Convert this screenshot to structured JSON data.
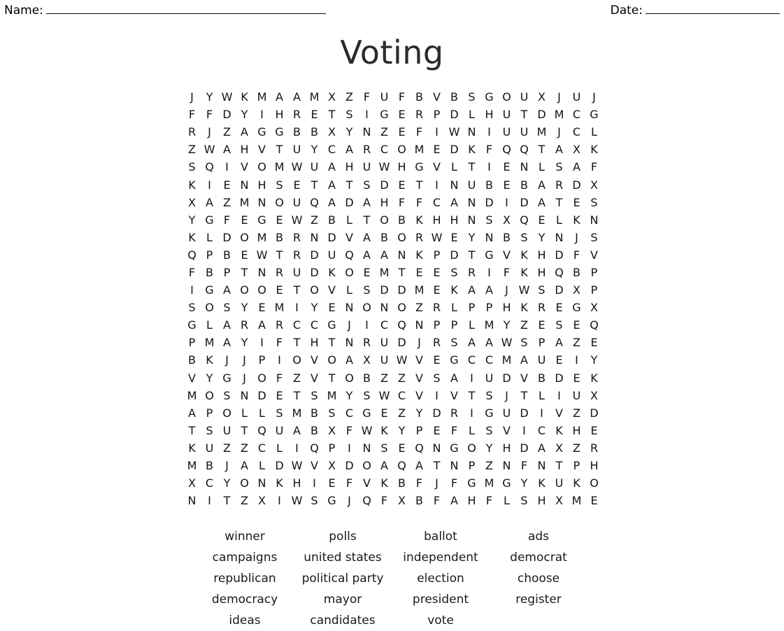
{
  "header": {
    "name_label": "Name:",
    "date_label": "Date:"
  },
  "title": "Voting",
  "grid": {
    "rows": 24,
    "cols": 24,
    "letters": [
      [
        "J",
        "Y",
        "W",
        "K",
        "M",
        "A",
        "A",
        "M",
        "X",
        "Z",
        "F",
        "U",
        "F",
        "B",
        "V",
        "B",
        "S",
        "G",
        "O",
        "U",
        "X",
        "J",
        "U",
        "J"
      ],
      [
        "F",
        "F",
        "D",
        "Y",
        "I",
        "H",
        "R",
        "E",
        "T",
        "S",
        "I",
        "G",
        "E",
        "R",
        "P",
        "D",
        "L",
        "H",
        "U",
        "T",
        "D",
        "M",
        "C",
        "G"
      ],
      [
        "R",
        "J",
        "Z",
        "A",
        "G",
        "G",
        "B",
        "B",
        "X",
        "Y",
        "N",
        "Z",
        "E",
        "F",
        "I",
        "W",
        "N",
        "I",
        "U",
        "U",
        "M",
        "J",
        "C",
        "L"
      ],
      [
        "Z",
        "W",
        "A",
        "H",
        "V",
        "T",
        "U",
        "Y",
        "C",
        "A",
        "R",
        "C",
        "O",
        "M",
        "E",
        "D",
        "K",
        "F",
        "Q",
        "Q",
        "T",
        "A",
        "X",
        "K"
      ],
      [
        "S",
        "Q",
        "I",
        "V",
        "O",
        "M",
        "W",
        "U",
        "A",
        "H",
        "U",
        "W",
        "H",
        "G",
        "V",
        "L",
        "T",
        "I",
        "E",
        "N",
        "L",
        "S",
        "A",
        "F"
      ],
      [
        "K",
        "I",
        "E",
        "N",
        "H",
        "S",
        "E",
        "T",
        "A",
        "T",
        "S",
        "D",
        "E",
        "T",
        "I",
        "N",
        "U",
        "B",
        "E",
        "B",
        "A",
        "R",
        "D",
        "X"
      ],
      [
        "X",
        "A",
        "Z",
        "M",
        "N",
        "O",
        "U",
        "Q",
        "A",
        "D",
        "A",
        "H",
        "F",
        "F",
        "C",
        "A",
        "N",
        "D",
        "I",
        "D",
        "A",
        "T",
        "E",
        "S"
      ],
      [
        "Y",
        "G",
        "F",
        "E",
        "G",
        "E",
        "W",
        "Z",
        "B",
        "L",
        "T",
        "O",
        "B",
        "K",
        "H",
        "H",
        "N",
        "S",
        "X",
        "Q",
        "E",
        "L",
        "K",
        "N"
      ],
      [
        "K",
        "L",
        "D",
        "O",
        "M",
        "B",
        "R",
        "N",
        "D",
        "V",
        "A",
        "B",
        "O",
        "R",
        "W",
        "E",
        "Y",
        "N",
        "B",
        "S",
        "Y",
        "N",
        "J",
        "S"
      ],
      [
        "Q",
        "P",
        "B",
        "E",
        "W",
        "T",
        "R",
        "D",
        "U",
        "Q",
        "A",
        "A",
        "N",
        "K",
        "P",
        "D",
        "T",
        "G",
        "V",
        "K",
        "H",
        "D",
        "F",
        "V"
      ],
      [
        "F",
        "B",
        "P",
        "T",
        "N",
        "R",
        "U",
        "D",
        "K",
        "O",
        "E",
        "M",
        "T",
        "E",
        "E",
        "S",
        "R",
        "I",
        "F",
        "K",
        "H",
        "Q",
        "B",
        "P"
      ],
      [
        "I",
        "G",
        "A",
        "O",
        "O",
        "E",
        "T",
        "O",
        "V",
        "L",
        "S",
        "D",
        "D",
        "M",
        "E",
        "K",
        "A",
        "A",
        "J",
        "W",
        "S",
        "D",
        "X",
        "P"
      ],
      [
        "S",
        "O",
        "S",
        "Y",
        "E",
        "M",
        "I",
        "Y",
        "E",
        "N",
        "O",
        "N",
        "O",
        "Z",
        "R",
        "L",
        "P",
        "P",
        "H",
        "K",
        "R",
        "E",
        "G",
        "X"
      ],
      [
        "G",
        "L",
        "A",
        "R",
        "A",
        "R",
        "C",
        "C",
        "G",
        "J",
        "I",
        "C",
        "Q",
        "N",
        "P",
        "P",
        "L",
        "M",
        "Y",
        "Z",
        "E",
        "S",
        "E",
        "Q"
      ],
      [
        "P",
        "M",
        "A",
        "Y",
        "I",
        "F",
        "T",
        "H",
        "T",
        "N",
        "R",
        "U",
        "D",
        "J",
        "R",
        "S",
        "A",
        "A",
        "W",
        "S",
        "P",
        "A",
        "Z",
        "E"
      ],
      [
        "B",
        "K",
        "J",
        "J",
        "P",
        "I",
        "O",
        "V",
        "O",
        "A",
        "X",
        "U",
        "W",
        "V",
        "E",
        "G",
        "C",
        "C",
        "M",
        "A",
        "U",
        "E",
        "I",
        "Y"
      ],
      [
        "V",
        "Y",
        "G",
        "J",
        "O",
        "F",
        "Z",
        "V",
        "T",
        "O",
        "B",
        "Z",
        "Z",
        "V",
        "S",
        "A",
        "I",
        "U",
        "D",
        "V",
        "B",
        "D",
        "E",
        "K"
      ],
      [
        "M",
        "O",
        "S",
        "N",
        "D",
        "E",
        "T",
        "S",
        "M",
        "Y",
        "S",
        "W",
        "C",
        "V",
        "I",
        "V",
        "T",
        "S",
        "J",
        "T",
        "L",
        "I",
        "U",
        "X"
      ],
      [
        "A",
        "P",
        "O",
        "L",
        "L",
        "S",
        "M",
        "B",
        "S",
        "C",
        "G",
        "E",
        "Z",
        "Y",
        "D",
        "R",
        "I",
        "G",
        "U",
        "D",
        "I",
        "V",
        "Z",
        "D"
      ],
      [
        "T",
        "S",
        "U",
        "T",
        "Q",
        "U",
        "A",
        "B",
        "X",
        "F",
        "W",
        "K",
        "Y",
        "P",
        "E",
        "F",
        "L",
        "S",
        "V",
        "I",
        "C",
        "K",
        "H",
        "E"
      ],
      [
        "K",
        "U",
        "Z",
        "Z",
        "C",
        "L",
        "I",
        "Q",
        "P",
        "I",
        "N",
        "S",
        "E",
        "Q",
        "N",
        "G",
        "O",
        "Y",
        "H",
        "D",
        "A",
        "X",
        "Z",
        "R"
      ],
      [
        "M",
        "B",
        "J",
        "A",
        "L",
        "D",
        "W",
        "V",
        "X",
        "D",
        "O",
        "A",
        "Q",
        "A",
        "T",
        "N",
        "P",
        "Z",
        "N",
        "F",
        "N",
        "T",
        "P",
        "H"
      ],
      [
        "X",
        "C",
        "Y",
        "O",
        "N",
        "K",
        "H",
        "I",
        "E",
        "F",
        "V",
        "K",
        "B",
        "F",
        "J",
        "F",
        "G",
        "M",
        "G",
        "Y",
        "K",
        "U",
        "K",
        "O"
      ],
      [
        "N",
        "I",
        "T",
        "Z",
        "X",
        "I",
        "W",
        "S",
        "G",
        "J",
        "Q",
        "F",
        "X",
        "B",
        "F",
        "A",
        "H",
        "F",
        "L",
        "S",
        "H",
        "X",
        "M",
        "E"
      ]
    ]
  },
  "word_list": {
    "rows": [
      [
        "winner",
        "polls",
        "ballot",
        "ads"
      ],
      [
        "campaigns",
        "united states",
        "independent",
        "democrat"
      ],
      [
        "republican",
        "political party",
        "election",
        "choose"
      ],
      [
        "democracy",
        "mayor",
        "president",
        "register"
      ],
      [
        "ideas",
        "candidates",
        "vote",
        ""
      ]
    ]
  }
}
